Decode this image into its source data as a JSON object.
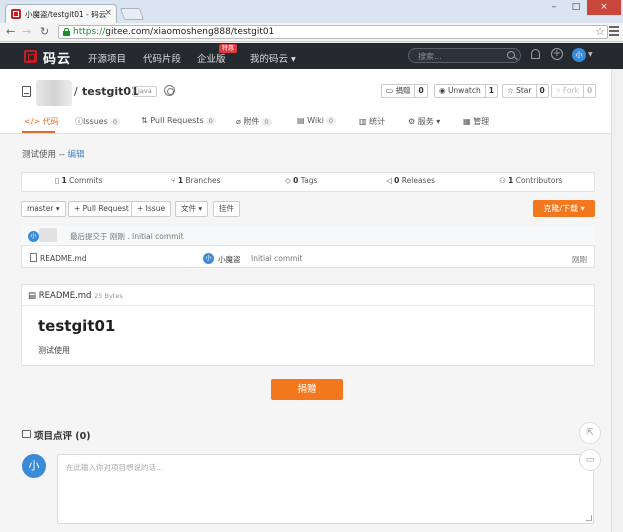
{
  "browser": {
    "tab_title": "小魔盗/testgit01 - 码云",
    "url_scheme": "https://",
    "url_rest": "gitee.com/xiaomosheng888/testgit01"
  },
  "site": {
    "logo_text": "码云",
    "nav": [
      "开源项目",
      "代码片段",
      "企业版",
      "我的码云"
    ],
    "enterprise_badge": "特惠",
    "search_placeholder": "搜索...",
    "avatar_letter": "小"
  },
  "repo": {
    "slash": "/",
    "name": "testgit01",
    "language": "Java",
    "actions": {
      "donate": {
        "label": "捐赠",
        "count": "0"
      },
      "unwatch": {
        "label": "Unwatch",
        "count": "1"
      },
      "star": {
        "label": "Star",
        "count": "0"
      },
      "fork": {
        "label": "Fork",
        "count": "0"
      }
    },
    "tabs": [
      {
        "label": "代码",
        "count": ""
      },
      {
        "label": "Issues",
        "count": "0"
      },
      {
        "label": "Pull Requests",
        "count": "0"
      },
      {
        "label": "附件",
        "count": "0"
      },
      {
        "label": "Wiki",
        "count": "0"
      },
      {
        "label": "统计",
        "count": ""
      },
      {
        "label": "服务",
        "count": ""
      },
      {
        "label": "管理",
        "count": ""
      }
    ],
    "description": "测试使用 --",
    "edit_label": "编辑"
  },
  "stats": [
    {
      "num": "1",
      "label": "Commits"
    },
    {
      "num": "1",
      "label": "Branches"
    },
    {
      "num": "0",
      "label": "Tags"
    },
    {
      "num": "0",
      "label": "Releases"
    },
    {
      "num": "1",
      "label": "Contributors"
    }
  ],
  "toolbar": {
    "branch": "master",
    "pull_request": "+ Pull Request",
    "issue": "+ Issue",
    "files": "文件",
    "widgets": "挂件",
    "clone": "克隆/下载"
  },
  "last_commit": {
    "text": "最后提交于 刚刚 . Initial commit",
    "avatar_letter": "小"
  },
  "files": [
    {
      "name": "README.md",
      "author": "小魔盗",
      "message": "Initial commit",
      "time": "刚刚",
      "avatar_letter": "小"
    }
  ],
  "readme": {
    "filename": "README.md",
    "size": "25 Bytes",
    "heading": "testgit01",
    "body": "测试使用"
  },
  "donate_button": "捐赠",
  "comments": {
    "title": "项目点评 (0)",
    "avatar_letter": "小",
    "placeholder": "在此输入你对项目想说的话..."
  }
}
